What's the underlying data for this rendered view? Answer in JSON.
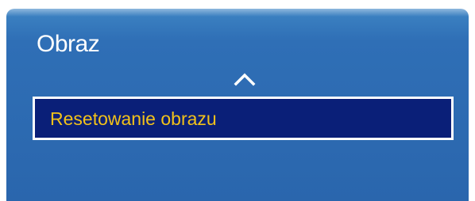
{
  "menu": {
    "title": "Obraz",
    "scroll_up_icon": "chevron-up-icon",
    "items": [
      {
        "label": "Resetowanie obrazu",
        "selected": true
      }
    ]
  },
  "colors": {
    "panel_blue": "#2f6fb6",
    "selected_bg": "#0a1f78",
    "selected_text": "#f2c21a",
    "title_text": "#ffffff"
  }
}
